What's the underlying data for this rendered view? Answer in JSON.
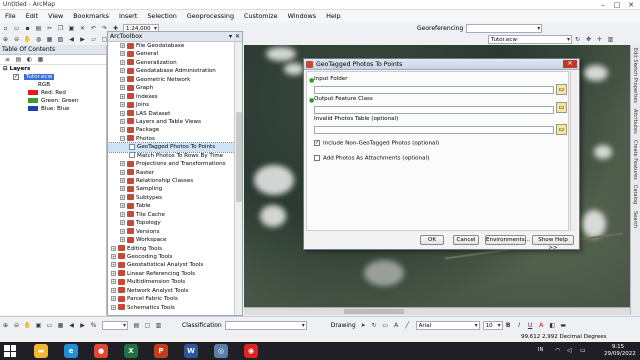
{
  "window": {
    "title": "Untitled - ArcMap",
    "controls": [
      "–",
      "□",
      "✕"
    ]
  },
  "menu": [
    "File",
    "Edit",
    "View",
    "Bookmarks",
    "Insert",
    "Selection",
    "Geoprocessing",
    "Customize",
    "Windows",
    "Help"
  ],
  "toolbar": {
    "scale": "1:24,000",
    "georef_label": "Georeferencing",
    "georef_layer": "Tutor.ecw",
    "classification_label": "Classification",
    "drawing_label": "Drawing",
    "font_name": "Arial",
    "font_size": "10",
    "text_style": [
      "B",
      "I",
      "U"
    ]
  },
  "toc": {
    "title": "Table Of Contents",
    "layers_label": "Layers",
    "layer_name": "Tutor.ecw",
    "rgb_label": "RGB",
    "bands": [
      {
        "label": "Red:",
        "value": "Red",
        "color": "#e31a1c"
      },
      {
        "label": "Green:",
        "value": "Green",
        "color": "#33a02c"
      },
      {
        "label": "Blue:",
        "value": "Blue",
        "color": "#1f3fb4"
      }
    ]
  },
  "toolbox": {
    "title": "ArcToolbox",
    "items": [
      {
        "label": "File Geodatabase",
        "kind": "folder",
        "indent": 1
      },
      {
        "label": "General",
        "kind": "folder",
        "indent": 1
      },
      {
        "label": "Generalization",
        "kind": "folder",
        "indent": 1
      },
      {
        "label": "Geodatabase Administration",
        "kind": "folder",
        "indent": 1
      },
      {
        "label": "Geometric Network",
        "kind": "folder",
        "indent": 1
      },
      {
        "label": "Graph",
        "kind": "folder",
        "indent": 1
      },
      {
        "label": "Indexes",
        "kind": "folder",
        "indent": 1
      },
      {
        "label": "Joins",
        "kind": "folder",
        "indent": 1
      },
      {
        "label": "LAS Dataset",
        "kind": "folder",
        "indent": 1
      },
      {
        "label": "Layers and Table Views",
        "kind": "folder",
        "indent": 1
      },
      {
        "label": "Package",
        "kind": "folder",
        "indent": 1
      },
      {
        "label": "Photos",
        "kind": "folder-open",
        "indent": 1
      },
      {
        "label": "GeoTagged Photos To Points",
        "kind": "tool-selected",
        "indent": 2
      },
      {
        "label": "Match Photos To Rows By Time",
        "kind": "tool",
        "indent": 2
      },
      {
        "label": "Projections and Transformations",
        "kind": "folder",
        "indent": 1
      },
      {
        "label": "Raster",
        "kind": "folder",
        "indent": 1
      },
      {
        "label": "Relationship Classes",
        "kind": "folder",
        "indent": 1
      },
      {
        "label": "Sampling",
        "kind": "folder",
        "indent": 1
      },
      {
        "label": "Subtypes",
        "kind": "folder",
        "indent": 1
      },
      {
        "label": "Table",
        "kind": "folder",
        "indent": 1
      },
      {
        "label": "Tile Cache",
        "kind": "folder",
        "indent": 1
      },
      {
        "label": "Topology",
        "kind": "folder",
        "indent": 1
      },
      {
        "label": "Versions",
        "kind": "folder",
        "indent": 1
      },
      {
        "label": "Workspace",
        "kind": "folder",
        "indent": 1
      },
      {
        "label": "Editing Tools",
        "kind": "toolbox",
        "indent": 0
      },
      {
        "label": "Geocoding Tools",
        "kind": "toolbox",
        "indent": 0
      },
      {
        "label": "Geostatistical Analyst Tools",
        "kind": "toolbox",
        "indent": 0
      },
      {
        "label": "Linear Referencing Tools",
        "kind": "toolbox",
        "indent": 0
      },
      {
        "label": "Multidimension Tools",
        "kind": "toolbox",
        "indent": 0
      },
      {
        "label": "Network Analyst Tools",
        "kind": "toolbox",
        "indent": 0
      },
      {
        "label": "Parcel Fabric Tools",
        "kind": "toolbox",
        "indent": 0
      },
      {
        "label": "Schematics Tools",
        "kind": "toolbox",
        "indent": 0
      }
    ]
  },
  "dialog": {
    "title": "GeoTagged Photos To Points",
    "input_folder_label": "Input Folder",
    "output_label": "Output Feature Class",
    "invalid_label": "Invalid Photos Table (optional)",
    "include_label": "Include Non-GeoTagged Photos (optional)",
    "include_checked": true,
    "attach_label": "Add Photos As Attachments (optional)",
    "attach_checked": false,
    "buttons": {
      "ok": "OK",
      "cancel": "Cancel",
      "environments": "Environments...",
      "help": "Show Help >>"
    }
  },
  "right_tabs": [
    "Edit Sketch Properties",
    "Attributes",
    "Create Features",
    "Catalog",
    "Search"
  ],
  "status": {
    "coords": "99,612  2,992 Decimal Degrees"
  },
  "taskbar": {
    "apps": [
      {
        "name": "file-explorer",
        "glyph": "▬",
        "color": "#f2b632"
      },
      {
        "name": "edge",
        "glyph": "e",
        "color": "#1f8fd6"
      },
      {
        "name": "chrome",
        "glyph": "●",
        "color": "#e3462f"
      },
      {
        "name": "excel",
        "glyph": "X",
        "color": "#1e7145"
      },
      {
        "name": "powerpoint",
        "glyph": "P",
        "color": "#c43e1c"
      },
      {
        "name": "word",
        "glyph": "W",
        "color": "#2b579a"
      },
      {
        "name": "arcmap",
        "glyph": "◎",
        "color": "#5b7fa8"
      },
      {
        "name": "record",
        "glyph": "◉",
        "color": "#d22"
      }
    ],
    "lang": "IN",
    "time": "9:15",
    "date": "29/09/2022"
  }
}
